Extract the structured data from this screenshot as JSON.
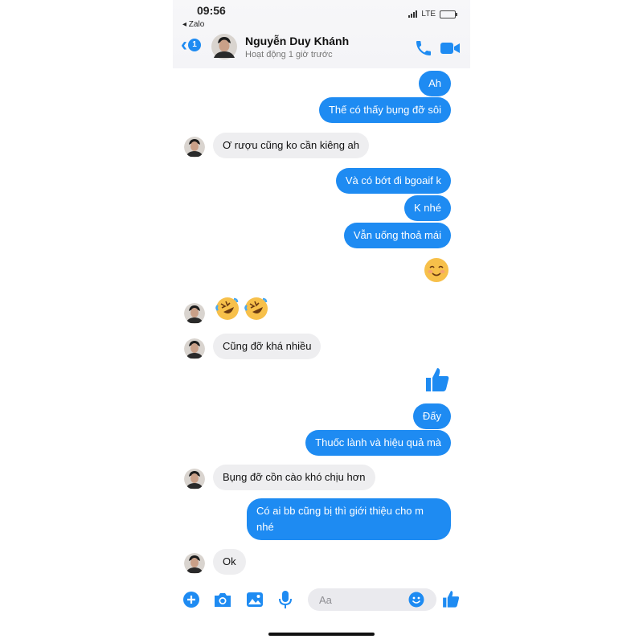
{
  "status_bar": {
    "time": "09:56",
    "back_app": "◂ Zalo",
    "network": "LTE"
  },
  "header": {
    "back_count": "1",
    "contact_name": "Nguyễn Duy Khánh",
    "contact_status": "Hoạt động 1 giờ trước",
    "icons": [
      "phone-icon",
      "video-call-icon"
    ]
  },
  "messages": [
    {
      "dir": "out",
      "text": "Ah"
    },
    {
      "dir": "out",
      "text": "Thế có thấy bụng đỡ sôi"
    },
    {
      "dir": "in",
      "text": "Ơ rượu cũng ko cần kiêng ah"
    },
    {
      "dir": "out",
      "text": "Và có bớt đi bgoaif k"
    },
    {
      "dir": "out",
      "text": "K nhé"
    },
    {
      "dir": "out",
      "text": "Vẫn uống thoả mái"
    },
    {
      "dir": "out",
      "emoji": "smiling-face"
    },
    {
      "dir": "in",
      "emoji": "rolling-laughing-x2"
    },
    {
      "dir": "in",
      "text": "Cũng đỡ khá nhiều"
    },
    {
      "dir": "out",
      "emoji": "thumbs-up"
    },
    {
      "dir": "out",
      "text": "Đấy"
    },
    {
      "dir": "out",
      "text": "Thuốc lành và hiệu quả mà"
    },
    {
      "dir": "in",
      "text": "Bụng đỡ cồn cào khó chịu hơn"
    },
    {
      "dir": "out",
      "text": "Có ai bb cũng bị thì giới thiệu cho m nhé"
    },
    {
      "dir": "in",
      "text": "Ok"
    }
  ],
  "composer": {
    "placeholder": "Aa",
    "icons": [
      "plus-icon",
      "camera-icon",
      "image-icon",
      "microphone-icon",
      "emoji-icon",
      "like-icon"
    ]
  },
  "colors": {
    "accent": "#1e8bf2",
    "incoming_bubble": "#eeeef0"
  }
}
